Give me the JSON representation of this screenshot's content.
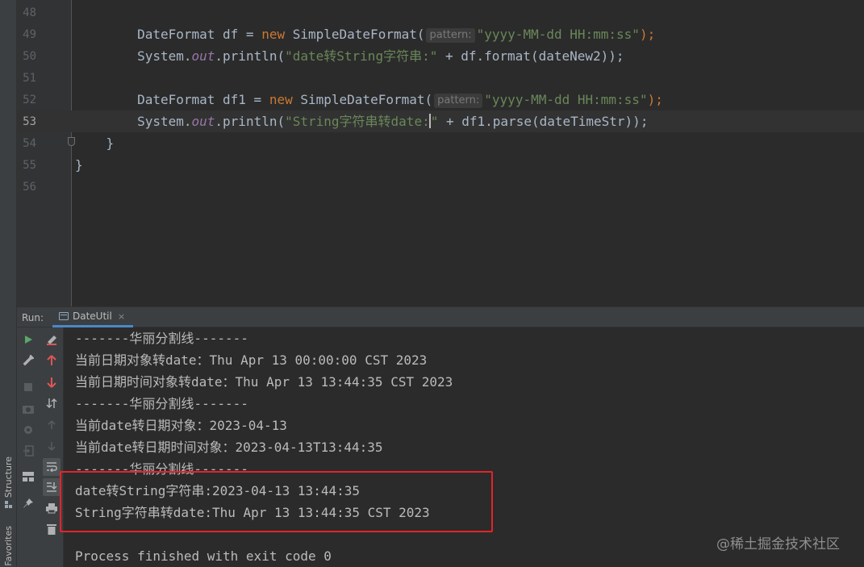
{
  "editor": {
    "lines": [
      {
        "no": "48"
      },
      {
        "no": "49",
        "indent": "        ",
        "type1": "DateFormat",
        "var": " df = ",
        "kw": "new",
        "call": " SimpleDateFormat(",
        "hint": "pattern:",
        "str": "\"yyyy-MM-dd HH:mm:ss\"",
        "end": ");"
      },
      {
        "no": "50",
        "indent": "        ",
        "obj": "System.",
        "fld": "out",
        "call": ".println(",
        "str": "\"date转String字符串:\"",
        "rest": " + df.format(dateNew2));"
      },
      {
        "no": "51"
      },
      {
        "no": "52",
        "indent": "        ",
        "type1": "DateFormat",
        "var": " df1 = ",
        "kw": "new",
        "call": " SimpleDateFormat(",
        "hint": "pattern:",
        "str": "\"yyyy-MM-dd HH:mm:ss\"",
        "end": ");"
      },
      {
        "no": "53",
        "indent": "        ",
        "obj": "System.",
        "fld": "out",
        "call": ".println(",
        "str_a": "\"String字符串转date:",
        "str_b": "\"",
        "rest": " + df1.parse(dateTimeStr));"
      },
      {
        "no": "54",
        "text": "    }"
      },
      {
        "no": "55",
        "text": "}"
      },
      {
        "no": "56"
      }
    ]
  },
  "run": {
    "label": "Run:",
    "tab_label": "DateUtil",
    "tab_close": "×"
  },
  "console": {
    "lines": [
      "-------华丽分割线-------",
      "当前日期对象转date：Thu Apr 13 00:00:00 CST 2023",
      "当前日期时间对象转date：Thu Apr 13 13:44:35 CST 2023",
      "-------华丽分割线-------",
      "当前date转日期对象：2023-04-13",
      "当前date转日期时间对象：2023-04-13T13:44:35",
      "-------华丽分割线-------",
      "date转String字符串:2023-04-13 13:44:35",
      "String字符串转date:Thu Apr 13 13:44:35 CST 2023",
      "",
      "Process finished with exit code 0"
    ]
  },
  "side_tabs": {
    "structure": "Structure",
    "favorites": "Favorites"
  },
  "watermark": "@稀土掘金技术社区",
  "colors": {
    "background": "#2b2b2b",
    "keyword": "#cc7832",
    "string": "#6a8759",
    "field": "#9876aa",
    "highlight_box": "#e5232a"
  }
}
